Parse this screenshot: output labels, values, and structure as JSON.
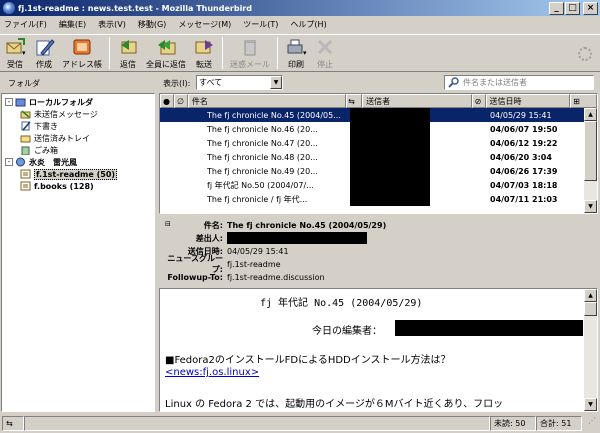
{
  "window": {
    "title": "fj.1st-readme : news.test.test - Mozilla Thunderbird"
  },
  "menu": [
    "ファイル(F)",
    "編集(E)",
    "表示(V)",
    "移動(G)",
    "メッセージ(M)",
    "ツール(T)",
    "ヘルプ(H)"
  ],
  "toolbar": [
    {
      "label": "受信",
      "icon": "get-mail-icon",
      "disabled": false
    },
    {
      "label": "作成",
      "icon": "compose-icon",
      "disabled": false
    },
    {
      "label": "アドレス帳",
      "icon": "address-book-icon",
      "disabled": false
    },
    {
      "label": "返信",
      "icon": "reply-icon",
      "disabled": false
    },
    {
      "label": "全員に返信",
      "icon": "reply-all-icon",
      "disabled": false
    },
    {
      "label": "転送",
      "icon": "forward-icon",
      "disabled": false
    },
    {
      "label": "迷惑メール",
      "icon": "junk-icon",
      "disabled": true
    },
    {
      "label": "印刷",
      "icon": "print-icon",
      "disabled": false
    },
    {
      "label": "停止",
      "icon": "stop-icon",
      "disabled": true
    }
  ],
  "folder_pane": {
    "label": "フォルダ",
    "items": [
      {
        "label": "ローカルフォルダ",
        "level": 0,
        "expander": "-",
        "bold": true,
        "icon": "local-folders-icon"
      },
      {
        "label": "未送信メッセージ",
        "level": 1,
        "icon": "unsent-folder-icon"
      },
      {
        "label": "下書き",
        "level": 1,
        "icon": "drafts-folder-icon"
      },
      {
        "label": "送信済みトレイ",
        "level": 1,
        "icon": "sent-folder-icon"
      },
      {
        "label": "ごみ箱",
        "level": 1,
        "icon": "trash-folder-icon"
      },
      {
        "label": "氷炎　雷光風",
        "level": 0,
        "expander": "-",
        "bold": true,
        "icon": "news-server-icon"
      },
      {
        "label": "f.1st-readme (50)",
        "level": 1,
        "bold": true,
        "selected": true,
        "icon": "newsgroup-icon"
      },
      {
        "label": "f.books (128)",
        "level": 1,
        "bold": true,
        "icon": "newsgroup-icon"
      }
    ]
  },
  "view": {
    "label": "表示(I):",
    "selected": "すべて"
  },
  "search": {
    "placeholder": "件名または送信者"
  },
  "thread_pane": {
    "columns": {
      "subject": "件名",
      "sender": "送信者",
      "date": "送信日時"
    },
    "rows": [
      {
        "subject": "The fj chronicle No.45 (2004/05...",
        "date": "04/05/29 15:41",
        "selected": true
      },
      {
        "subject": "The fj chronicle No.46 (20...",
        "date": "04/06/07 19:50"
      },
      {
        "subject": "The fj chronicle No.47 (20...",
        "date": "04/06/12 19:22"
      },
      {
        "subject": "The fj chronicle No.48 (20...",
        "date": "04/06/20 3:04"
      },
      {
        "subject": "The fj chronicle No.49 (20...",
        "date": "04/06/26 17:39"
      },
      {
        "subject": "fj 年代記 No.50 (2004/07/...",
        "date": "04/07/03 18:18"
      },
      {
        "subject": "The fj chronicle / fj 年代...",
        "date": "04/07/11 21:03"
      }
    ]
  },
  "message_header": {
    "subject_label": "件名:",
    "subject": "The fj chronicle No.45 (2004/05/29)",
    "from_label": "差出人:",
    "date_label": "送信日時:",
    "date": "04/05/29 15:41",
    "newsgroups_label": "ニュースグループ:",
    "newsgroups": "fj.1st-readme",
    "followup_label": "Followup-To:",
    "followup": "fj.1st-readme.discussion"
  },
  "message_body": {
    "title": "fj 年代記 No.45 (2004/05/29)",
    "editor_label": "今日の編集者：",
    "heading": "■Fedora2のインストールFDによるHDDインストール方法は？",
    "link": "<news:fj.os.linux>",
    "text": "Linux の Fedora 2 では、起動用のイメージが６Mバイト近くあり、フロッ"
  },
  "status": {
    "unread": "未読: 50",
    "total": "合計: 51"
  }
}
